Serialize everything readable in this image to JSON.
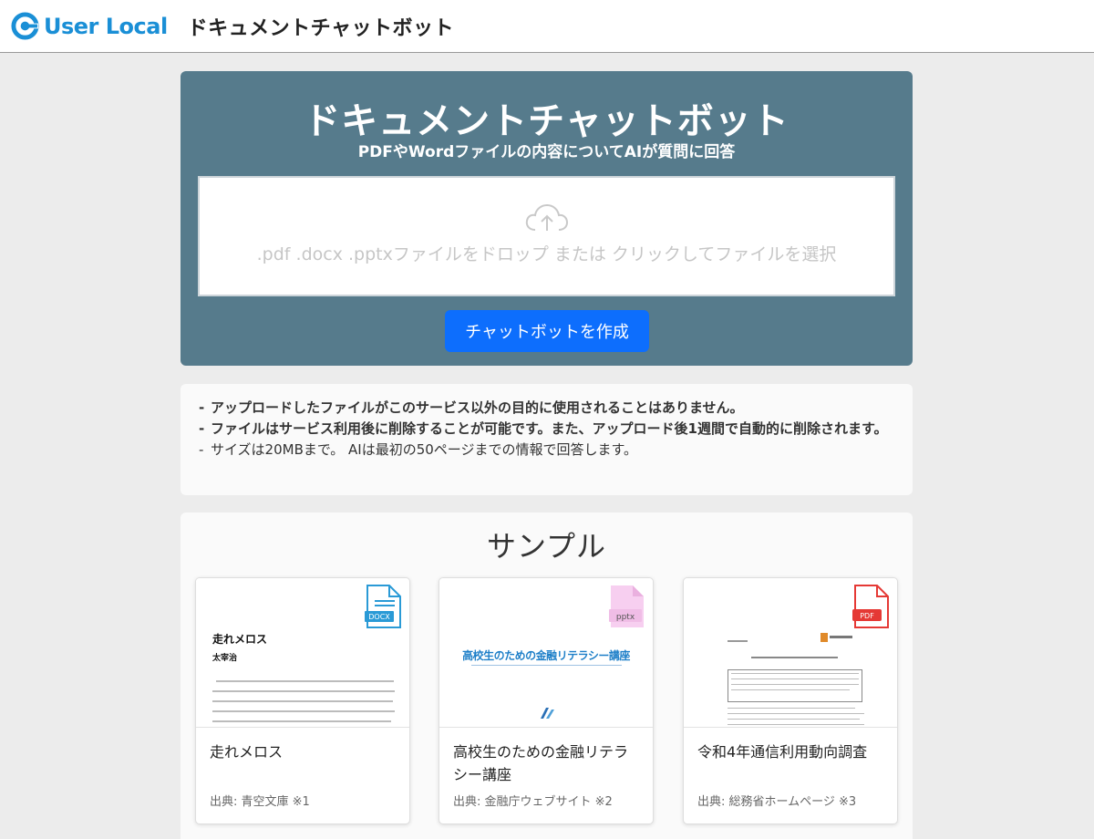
{
  "header": {
    "logo_text": "User Local",
    "app_title": "ドキュメントチャットボット"
  },
  "hero": {
    "title": "ドキュメントチャットボット",
    "subtitle": "PDFやWordファイルの内容についてAIが質問に回答",
    "dropzone_text": ".pdf .docx .pptxファイルをドロップ または クリックしてファイルを選択",
    "create_button": "チャットボットを作成"
  },
  "notice": {
    "items": [
      "アップロードしたファイルがこのサービス以外の目的に使用されることはありません。",
      "ファイルはサービス利用後に削除することが可能です。また、アップロード後1週間で自動的に削除されます。",
      "サイズは20MBまで。 AIは最初の50ページまでの情報で回答します。"
    ]
  },
  "samples": {
    "heading": "サンプル",
    "cards": [
      {
        "title": "走れメロス",
        "source": "出典: 青空文庫 ※1",
        "file_type": "DOCX",
        "thumb_title": "走れメロス",
        "thumb_author": "太宰治"
      },
      {
        "title": "高校生のための金融リテラシー講座",
        "source": "出典: 金融庁ウェブサイト ※2",
        "file_type": "pptx",
        "thumb_title": "高校生のための金融リテラシー講座"
      },
      {
        "title": "令和4年通信利用動向調査",
        "source": "出典: 総務省ホームページ ※3",
        "file_type": "PDF"
      }
    ]
  },
  "colors": {
    "brand": "#1a8fd6",
    "hero_bg": "#567b8c",
    "primary_button": "#0d6efd"
  },
  "icons": [
    "userlocal-logo-icon",
    "cloud-upload-icon",
    "docx-file-icon",
    "pptx-file-icon",
    "pdf-file-icon"
  ]
}
